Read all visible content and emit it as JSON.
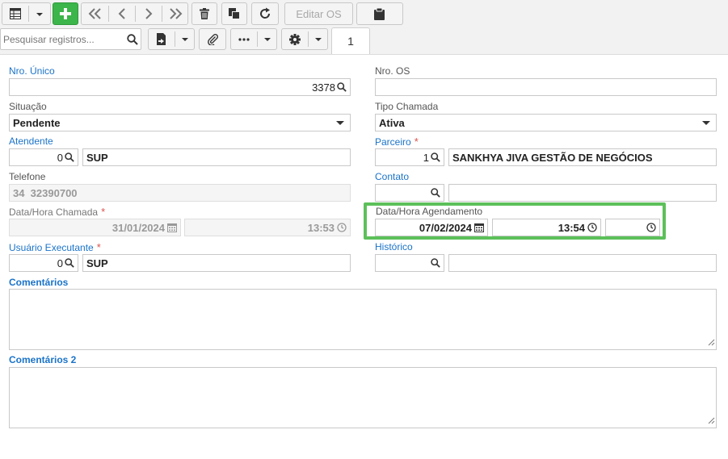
{
  "toolbar": {
    "edit_os_label": "Editar OS",
    "search_placeholder": "Pesquisar registros...",
    "page_number": "1"
  },
  "form": {
    "nro_unico": {
      "label": "Nro. Único",
      "value": "3378"
    },
    "nro_os": {
      "label": "Nro. OS",
      "value": ""
    },
    "situacao": {
      "label": "Situação",
      "value": "Pendente"
    },
    "tipo_chamada": {
      "label": "Tipo Chamada",
      "value": "Ativa"
    },
    "atendente": {
      "label": "Atendente",
      "code": "0",
      "name": "SUP"
    },
    "parceiro": {
      "label": "Parceiro",
      "code": "1",
      "name": "SANKHYA JIVA GESTÃO DE NEGÓCIOS"
    },
    "telefone": {
      "label": "Telefone",
      "value": "34  32390700"
    },
    "contato": {
      "label": "Contato",
      "code": "",
      "name": ""
    },
    "data_hora_chamada": {
      "label": "Data/Hora Chamada",
      "date": "31/01/2024",
      "time": "13:53"
    },
    "data_hora_agendamento": {
      "label": "Data/Hora Agendamento",
      "date": "07/02/2024",
      "time": "13:54",
      "time2": ""
    },
    "usuario_executante": {
      "label": "Usuário Executante",
      "code": "0",
      "name": "SUP"
    },
    "historico": {
      "label": "Histórico",
      "code": "",
      "name": ""
    },
    "comentarios": {
      "label": "Comentários",
      "value": ""
    },
    "comentarios2": {
      "label": "Comentários 2",
      "value": ""
    }
  },
  "colors": {
    "accent_blue": "#1a73c9",
    "add_green": "#3cb54a",
    "highlight_green": "#5cc05a",
    "required_red": "#d9534f"
  }
}
